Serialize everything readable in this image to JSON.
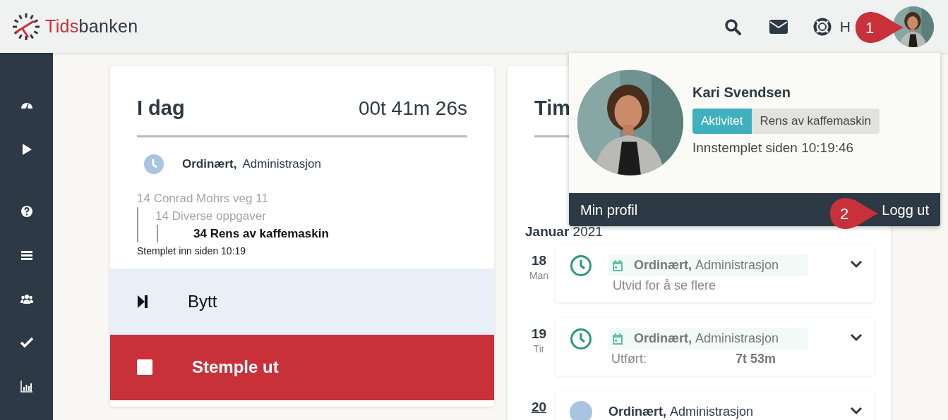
{
  "header": {
    "logo": {
      "part_1": "Tids",
      "part_2": "banken"
    },
    "help_label": "H",
    "callout": "1"
  },
  "today_card": {
    "title": "I dag",
    "timer": "00t 41m 26s",
    "entry": {
      "type": "Ordinært,",
      "activity": "Administrasjon"
    },
    "tree": [
      {
        "label": "14 Conrad Mohrs veg 11",
        "current": false,
        "children": [
          {
            "label": "14 Diverse oppgaver",
            "current": false,
            "children": [
              {
                "label": "34 Rens av kaffemaskin",
                "current": true
              }
            ]
          }
        ]
      }
    ],
    "stamped_in": "Stemplet inn siden 10:19",
    "actions": [
      {
        "kind": "switch",
        "label": "Bytt"
      },
      {
        "kind": "stamp_out",
        "label": "Stemple ut"
      }
    ]
  },
  "timeline_card": {
    "title": "Tim",
    "month": "Januar",
    "year": "2021",
    "days": [
      {
        "day": "18",
        "weekday": "Man",
        "today": false,
        "kind": "registered",
        "type": "Ordinært,",
        "activity": "Administrasjon",
        "note": "Utvid for å se flere"
      },
      {
        "day": "19",
        "weekday": "Tir",
        "today": false,
        "kind": "registered",
        "type": "Ordinært,",
        "activity": "Administrasjon",
        "done_label": "Utført:",
        "done_value": "7t 53m"
      },
      {
        "day": "20",
        "today": true,
        "kind": "pending",
        "type": "Ordinært,",
        "activity": "Administrasjon"
      }
    ]
  },
  "profile_menu": {
    "name": "Kari Svendsen",
    "tag_label": "Aktivitet",
    "tag_value": "Rens av kaffemaskin",
    "since": "Innstemplet siden 10:19:46",
    "links": [
      "Min profil",
      "Logg ut"
    ],
    "callout": "2"
  }
}
